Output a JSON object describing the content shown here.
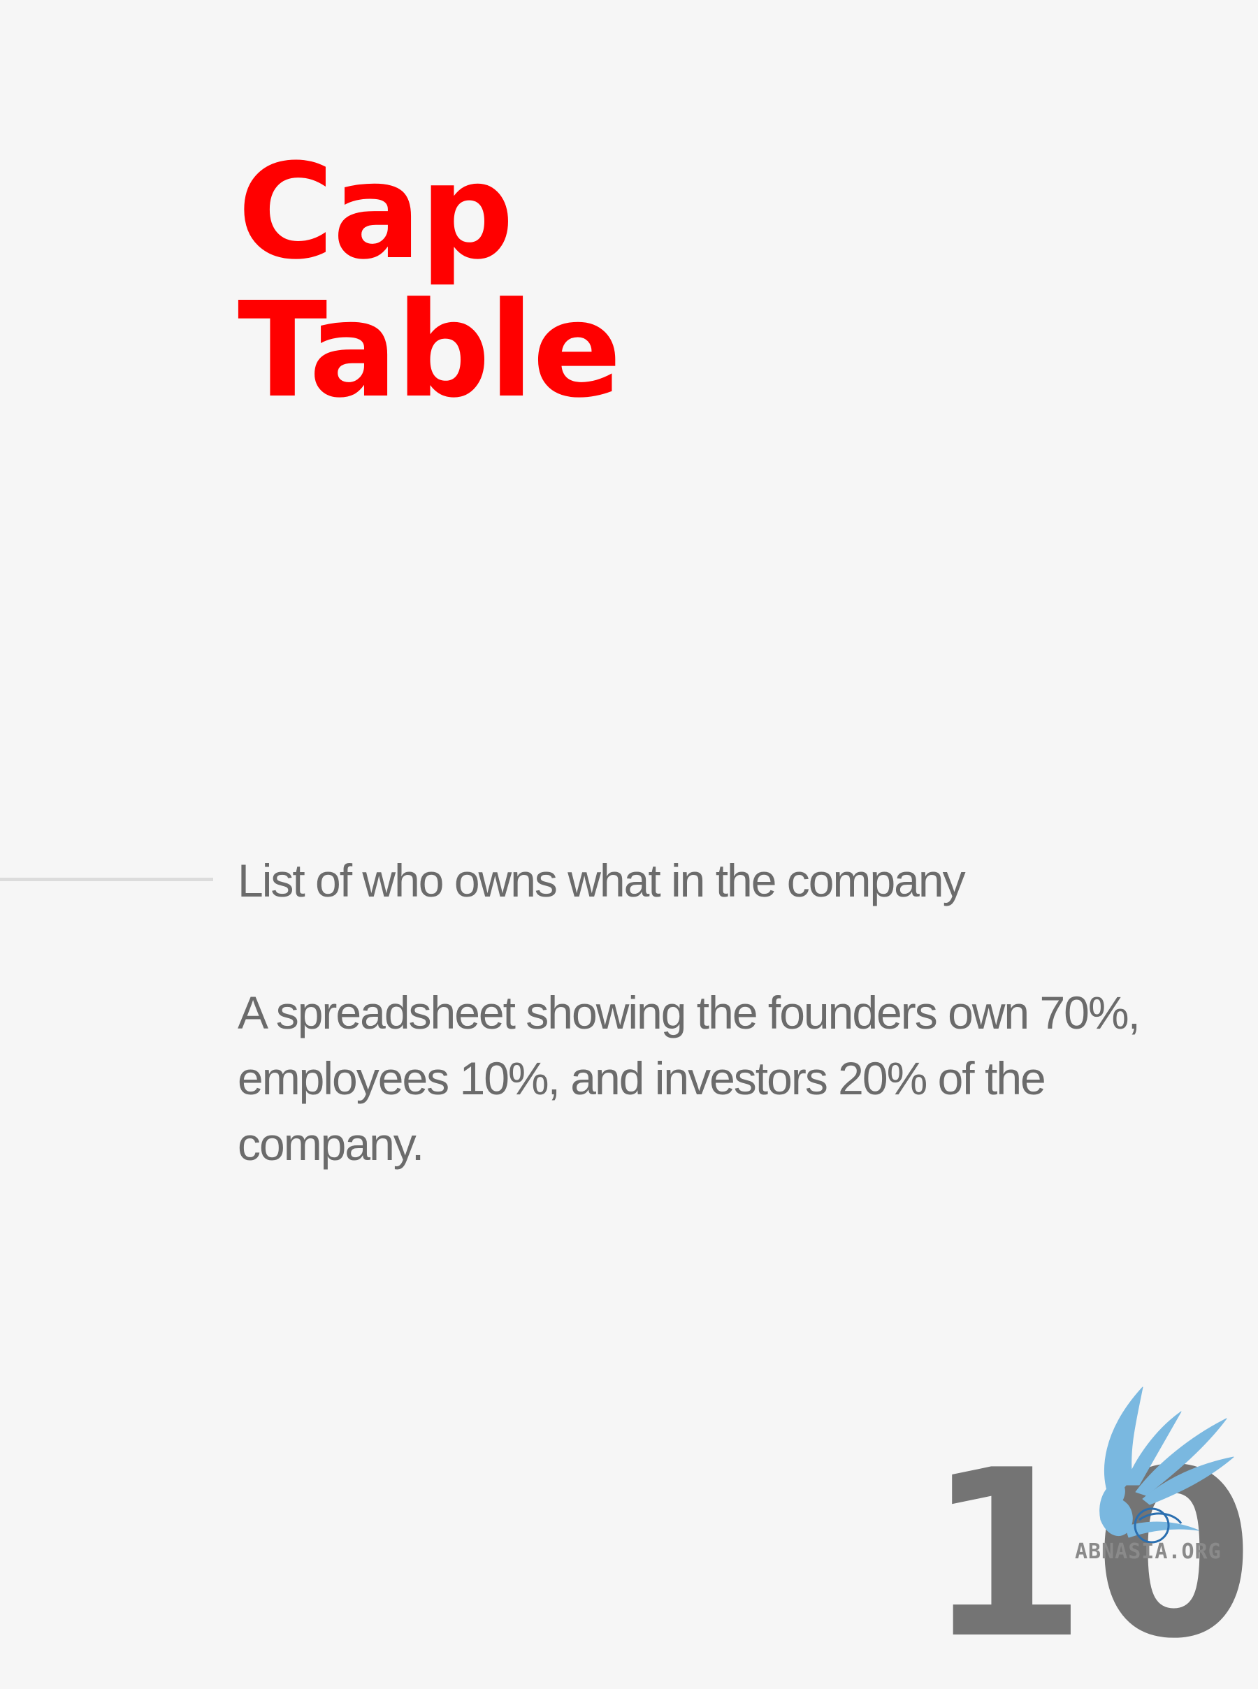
{
  "slide": {
    "title_line1": "Cap",
    "title_line2": "Table",
    "definition": "List of who owns what in the company",
    "example": "A spreadsheet showing the founders own 70%, employees 10%, and investors 20% of the company.",
    "page_number": "10"
  },
  "logo": {
    "text": "ABNASIA.ORG",
    "icon": "phoenix-bird-icon"
  },
  "colors": {
    "background": "#f6f6f6",
    "title": "#ff0000",
    "body_text": "#6b6b6b",
    "page_number": "#747474",
    "logo_bird": "#7ab8e0",
    "divider": "#dcdcdc"
  }
}
